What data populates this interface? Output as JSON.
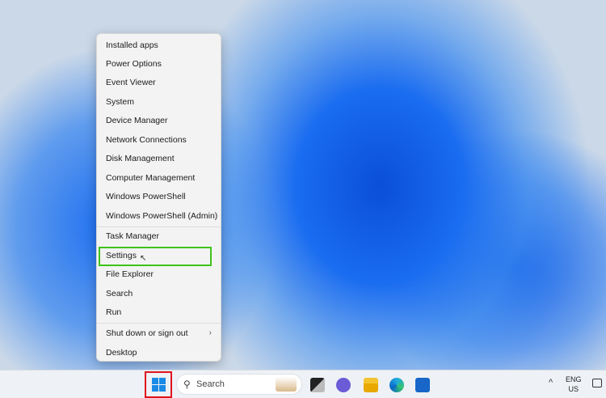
{
  "menu": {
    "items": [
      "Installed apps",
      "Power Options",
      "Event Viewer",
      "System",
      "Device Manager",
      "Network Connections",
      "Disk Management",
      "Computer Management",
      "Windows PowerShell",
      "Windows PowerShell (Admin)",
      "Task Manager",
      "Settings",
      "File Explorer",
      "Search",
      "Run",
      "Shut down or sign out",
      "Desktop"
    ],
    "highlighted": "Settings"
  },
  "taskbar": {
    "search_placeholder": "Search",
    "lang": "ENG",
    "region": "US"
  },
  "colors": {
    "highlight": "#3ec31b",
    "start_outline": "#e0121e"
  }
}
